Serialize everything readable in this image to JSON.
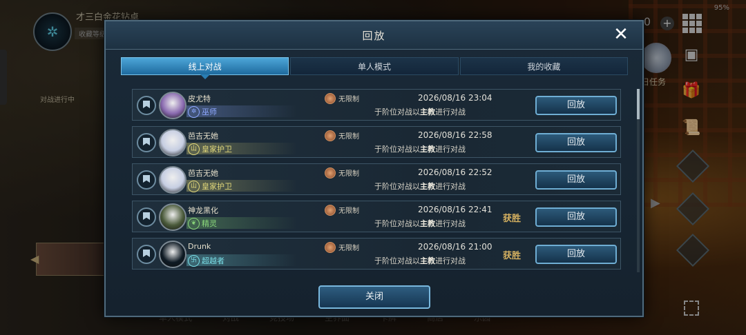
{
  "status": {
    "battery": "95%"
  },
  "background": {
    "player_name": "才三白金花钻卓",
    "player_sub": "收藏等级",
    "left_task": "对战进行中",
    "currency_value": "0",
    "task_label": "日任务",
    "bottom_nav": [
      "单人模式",
      "对战",
      "竞技场",
      "主界面",
      "卡牌",
      "商店",
      "乐园"
    ]
  },
  "modal": {
    "title": "回放",
    "close_label": "关闭",
    "tabs": [
      {
        "label": "线上对战",
        "active": true
      },
      {
        "label": "单人模式",
        "active": false
      },
      {
        "label": "我的收藏",
        "active": false
      }
    ],
    "replay_label": "回放",
    "records": [
      {
        "hero": "皮尤特",
        "class_name": "巫师",
        "class_color": "#8ea8ff",
        "class_icon": "✲",
        "avatar_color": "#8a6ab0",
        "mode": "无限制",
        "datetime": "2026/08/16  23:04",
        "desc": "于阶位对战以主教进行对战",
        "result": ""
      },
      {
        "hero": "芭吉无她",
        "class_name": "皇家护卫",
        "class_color": "#e2d87a",
        "class_icon": "山",
        "avatar_color": "#c6cee2",
        "mode": "无限制",
        "datetime": "2026/08/16  22:58",
        "desc": "于阶位对战以主教进行对战",
        "result": ""
      },
      {
        "hero": "芭吉无她",
        "class_name": "皇家护卫",
        "class_color": "#e2d87a",
        "class_icon": "山",
        "avatar_color": "#c6cee2",
        "mode": "无限制",
        "datetime": "2026/08/16  22:52",
        "desc": "于阶位对战以主教进行对战",
        "result": ""
      },
      {
        "hero": "神龙黑化",
        "class_name": "精灵",
        "class_color": "#8ad67a",
        "class_icon": "❦",
        "avatar_color": "#4a5a3a",
        "mode": "无限制",
        "datetime": "2026/08/16  22:41",
        "desc": "于阶位对战以主教进行对战",
        "result": "获胜"
      },
      {
        "hero": "Drunk",
        "class_name": "超越者",
        "class_color": "#7adfe8",
        "class_icon": "卐",
        "avatar_color": "#0e1a24",
        "mode": "无限制",
        "datetime": "2026/08/16  21:00",
        "desc": "于阶位对战以主教进行对战",
        "result": "获胜"
      }
    ]
  },
  "icons": {
    "close": "close-icon",
    "bookmark": "bookmark-icon",
    "mode": "infinity-icon",
    "grid": "grid-menu-icon",
    "fullscreen": "fullscreen-icon"
  }
}
